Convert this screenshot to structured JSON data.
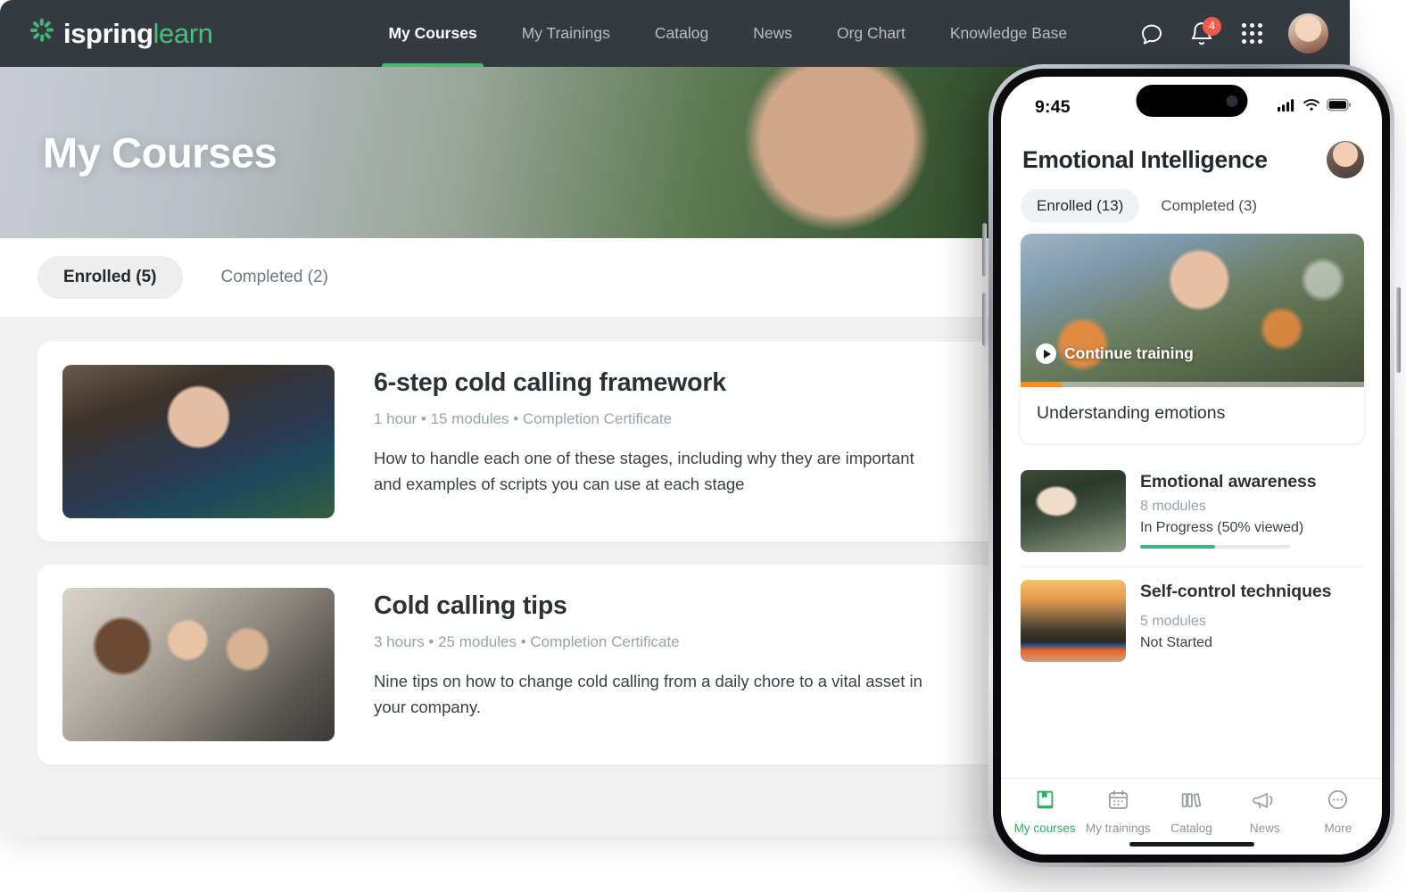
{
  "brand": {
    "name_part1": "ispring",
    "name_part2": "learn",
    "accent": "#48c07d",
    "logo_icon": "burst-icon"
  },
  "desktop": {
    "nav": [
      {
        "label": "My Courses",
        "active": true
      },
      {
        "label": "My Trainings",
        "active": false
      },
      {
        "label": "Catalog",
        "active": false
      },
      {
        "label": "News",
        "active": false
      },
      {
        "label": "Org Chart",
        "active": false
      },
      {
        "label": "Knowledge Base",
        "active": false
      }
    ],
    "topright": {
      "chat_icon": "chat-bubble-icon",
      "bell_icon": "bell-icon",
      "notification_count": "4",
      "apps_icon": "grid-apps-icon",
      "avatar": "user-avatar"
    },
    "hero": {
      "title": "My Courses"
    },
    "tabs": [
      {
        "label": "Enrolled (5)",
        "active": true
      },
      {
        "label": "Completed (2)",
        "active": false
      }
    ],
    "courses": [
      {
        "title": "6-step cold calling framework",
        "meta": "1 hour • 15 modules  •  Completion Certificate",
        "description": "How to handle each one of these stages, including why they are important and examples of scripts you can use at each stage",
        "thumb": "headset-agent-photo",
        "has_flag": false
      },
      {
        "title": "Cold calling tips",
        "meta": "3 hours • 25 modules  •  Completion Certificate",
        "description": "Nine tips on how to change cold calling from a daily chore to a vital asset in your company.",
        "thumb": "team-meeting-photo",
        "has_flag": true,
        "flag_icon": "flag-icon"
      }
    ]
  },
  "phone": {
    "status": {
      "time": "9:45",
      "signal_icon": "cellular-signal-icon",
      "wifi_icon": "wifi-icon",
      "battery_icon": "battery-icon"
    },
    "header": {
      "title": "Emotional Intelligence",
      "avatar": "user-avatar"
    },
    "tabs": [
      {
        "label": "Enrolled (13)",
        "active": true
      },
      {
        "label": "Completed (3)",
        "active": false
      }
    ],
    "featured": {
      "continue_label": "Continue training",
      "play_icon": "play-circle-icon",
      "name": "Understanding emotions",
      "progress_percent": 12,
      "progress_color": "#f59020",
      "image": "woman-in-flower-field-photo"
    },
    "list": [
      {
        "title": "Emotional awareness",
        "modules": "8 modules",
        "status": "In Progress (50% viewed)",
        "progress_percent": 50,
        "progress_color": "#3cb878",
        "thumb": "hands-in-water-photo"
      },
      {
        "title": "Self-control techniques",
        "modules": "5 modules",
        "status": "Not Started",
        "progress_percent": 0,
        "thumb": "mountain-hiker-photo"
      }
    ],
    "tabbar": [
      {
        "label": "My courses",
        "icon": "book-bookmark-icon",
        "active": true
      },
      {
        "label": "My trainings",
        "icon": "calendar-icon",
        "active": false
      },
      {
        "label": "Catalog",
        "icon": "books-shelf-icon",
        "active": false
      },
      {
        "label": "News",
        "icon": "megaphone-icon",
        "active": false
      },
      {
        "label": "More",
        "icon": "more-circle-icon",
        "active": false
      }
    ]
  }
}
